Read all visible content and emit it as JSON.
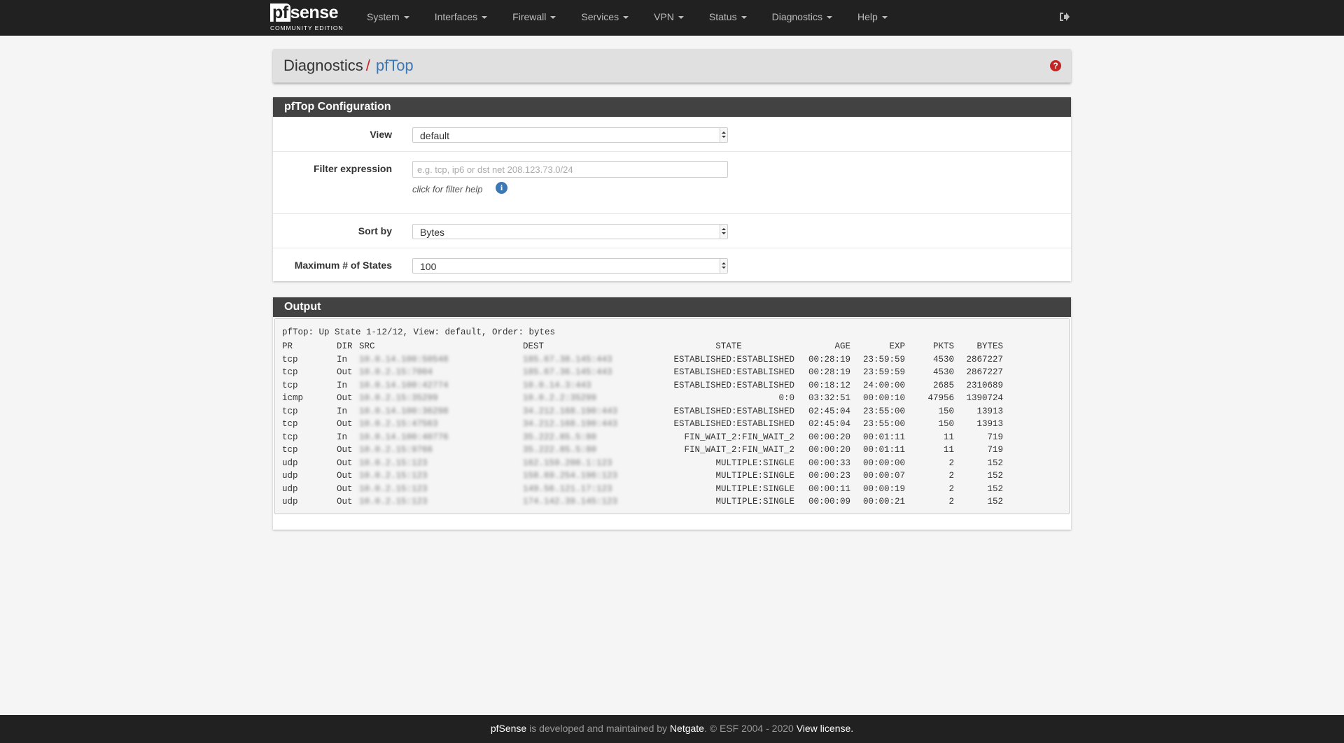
{
  "brand": {
    "logo_text": "pfsense",
    "edition": "COMMUNITY EDITION"
  },
  "nav": {
    "items": [
      {
        "label": "System"
      },
      {
        "label": "Interfaces"
      },
      {
        "label": "Firewall"
      },
      {
        "label": "Services"
      },
      {
        "label": "VPN"
      },
      {
        "label": "Status"
      },
      {
        "label": "Diagnostics"
      },
      {
        "label": "Help"
      }
    ],
    "logout_icon": "sign-out-icon"
  },
  "header": {
    "root": "Diagnostics",
    "separator": "/",
    "current": "pfTop",
    "help_icon": "question-circle-icon"
  },
  "config": {
    "title": "pfTop Configuration",
    "view_label": "View",
    "view_value": "default",
    "filter_label": "Filter expression",
    "filter_placeholder": "e.g. tcp, ip6 or dst net 208.123.73.0/24",
    "filter_value": "",
    "filter_help": "click for filter help",
    "sort_label": "Sort by",
    "sort_value": "Bytes",
    "max_label": "Maximum # of States",
    "max_value": "100"
  },
  "output": {
    "title": "Output",
    "status_line": "pfTop: Up State 1-12/12, View: default, Order: bytes",
    "columns": {
      "pr": "PR",
      "dir": "DIR",
      "src": "SRC",
      "dest": "DEST",
      "state": "STATE",
      "age": "AGE",
      "exp": "EXP",
      "pkts": "PKTS",
      "bytes": "BYTES"
    },
    "rows": [
      {
        "pr": "tcp",
        "dir": "In",
        "src": "10.0.14.100:50548",
        "dest": "185.67.38.145:443",
        "state": "ESTABLISHED:ESTABLISHED",
        "age": "00:28:19",
        "exp": "23:59:59",
        "pkts": "4530",
        "bytes": "2867227"
      },
      {
        "pr": "tcp",
        "dir": "Out",
        "src": "10.0.2.15:7004",
        "dest": "185.67.36.145:443",
        "state": "ESTABLISHED:ESTABLISHED",
        "age": "00:28:19",
        "exp": "23:59:59",
        "pkts": "4530",
        "bytes": "2867227"
      },
      {
        "pr": "tcp",
        "dir": "In",
        "src": "10.0.14.100:42774",
        "dest": "10.0.14.3:443",
        "state": "ESTABLISHED:ESTABLISHED",
        "age": "00:18:12",
        "exp": "24:00:00",
        "pkts": "2685",
        "bytes": "2310689"
      },
      {
        "pr": "icmp",
        "dir": "Out",
        "src": "10.0.2.15:35299",
        "dest": "10.0.2.2:35299",
        "state": "0:0",
        "age": "03:32:51",
        "exp": "00:00:10",
        "pkts": "47956",
        "bytes": "1390724"
      },
      {
        "pr": "tcp",
        "dir": "In",
        "src": "10.0.14.100:36298",
        "dest": "34.212.168.190:443",
        "state": "ESTABLISHED:ESTABLISHED",
        "age": "02:45:04",
        "exp": "23:55:00",
        "pkts": "150",
        "bytes": "13913"
      },
      {
        "pr": "tcp",
        "dir": "Out",
        "src": "10.0.2.15:47563",
        "dest": "34.212.168.190:443",
        "state": "ESTABLISHED:ESTABLISHED",
        "age": "02:45:04",
        "exp": "23:55:00",
        "pkts": "150",
        "bytes": "13913"
      },
      {
        "pr": "tcp",
        "dir": "In",
        "src": "10.0.14.100:40776",
        "dest": "35.222.85.5:80",
        "state": "FIN_WAIT_2:FIN_WAIT_2",
        "age": "00:00:20",
        "exp": "00:01:11",
        "pkts": "11",
        "bytes": "719"
      },
      {
        "pr": "tcp",
        "dir": "Out",
        "src": "10.0.2.15:9766",
        "dest": "35.222.85.5:80",
        "state": "FIN_WAIT_2:FIN_WAIT_2",
        "age": "00:00:20",
        "exp": "00:01:11",
        "pkts": "11",
        "bytes": "719"
      },
      {
        "pr": "udp",
        "dir": "Out",
        "src": "10.0.2.15:123",
        "dest": "162.159.200.1:123",
        "state": "MULTIPLE:SINGLE",
        "age": "00:00:33",
        "exp": "00:00:00",
        "pkts": "2",
        "bytes": "152"
      },
      {
        "pr": "udp",
        "dir": "Out",
        "src": "10.0.2.15:123",
        "dest": "158.69.254.196:123",
        "state": "MULTIPLE:SINGLE",
        "age": "00:00:23",
        "exp": "00:00:07",
        "pkts": "2",
        "bytes": "152"
      },
      {
        "pr": "udp",
        "dir": "Out",
        "src": "10.0.2.15:123",
        "dest": "149.56.121.17:123",
        "state": "MULTIPLE:SINGLE",
        "age": "00:00:11",
        "exp": "00:00:19",
        "pkts": "2",
        "bytes": "152"
      },
      {
        "pr": "udp",
        "dir": "Out",
        "src": "10.0.2.15:123",
        "dest": "174.142.39.145:123",
        "state": "MULTIPLE:SINGLE",
        "age": "00:00:09",
        "exp": "00:00:21",
        "pkts": "2",
        "bytes": "152"
      }
    ]
  },
  "footer": {
    "brand": "pfSense",
    "text1": " is developed and maintained by ",
    "company": "Netgate",
    "text2": ". © ESF 2004 - 2020 ",
    "license": "View license."
  }
}
